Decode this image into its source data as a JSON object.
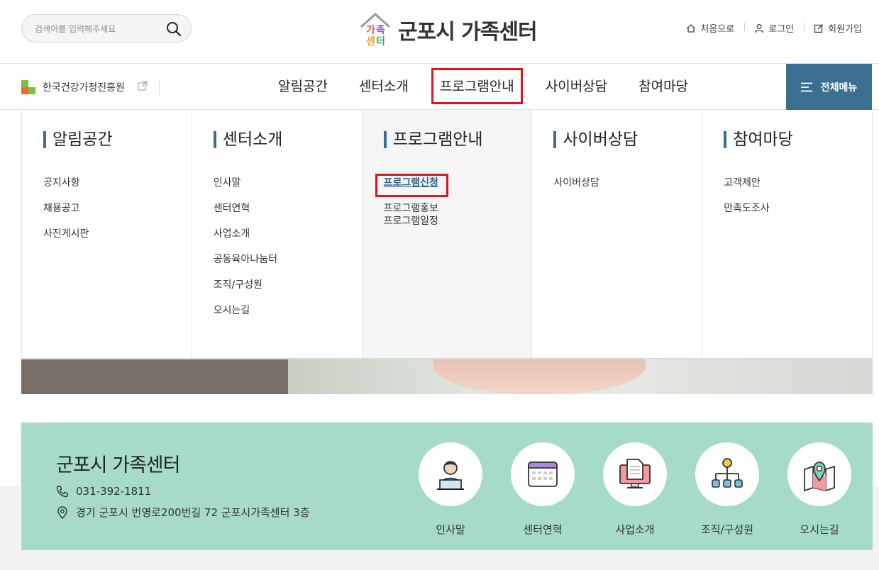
{
  "search": {
    "placeholder": "검색어를 입력해주세요",
    "icon": "search-icon"
  },
  "logo": {
    "mark_text": "가족센터",
    "title": "군포시 가족센터"
  },
  "util_links": [
    {
      "label": "처음으로",
      "icon": "home-icon"
    },
    {
      "label": "로그인",
      "icon": "user-icon"
    },
    {
      "label": "회원가입",
      "icon": "edit-icon"
    }
  ],
  "org": {
    "label": "한국건강가정진흥원",
    "icon": "external-link-icon"
  },
  "nav": [
    "알림공간",
    "센터소개",
    "프로그램안내",
    "사이버상담",
    "참여마당"
  ],
  "all_menu": {
    "label": "전체메뉴",
    "icon": "hamburger-icon"
  },
  "mega": [
    {
      "title": "알림공간",
      "items": [
        "공지사항",
        "채용공고",
        "사진게시판"
      ]
    },
    {
      "title": "센터소개",
      "items": [
        "인사말",
        "센터연혁",
        "사업소개",
        "공동육아나눔터",
        "조직/구성원",
        "오시는길"
      ]
    },
    {
      "title": "프로그램안내",
      "items": [
        "프로그램신청",
        "프로그램홍보",
        "프로그램일정"
      ]
    },
    {
      "title": "사이버상담",
      "items": [
        "사이버상담"
      ]
    },
    {
      "title": "참여마당",
      "items": [
        "고객제안",
        "만족도조사"
      ]
    }
  ],
  "center": {
    "title": "군포시 가족센터",
    "phone": "031-392-1811",
    "address": "경기 군포시 번영로200번길 72 군포시가족센터 3층"
  },
  "quick_links": [
    {
      "label": "인사말",
      "icon": "greeting-person-icon"
    },
    {
      "label": "센터연혁",
      "icon": "calendar-icon"
    },
    {
      "label": "사업소개",
      "icon": "monitor-document-icon"
    },
    {
      "label": "조직/구성원",
      "icon": "org-chart-icon"
    },
    {
      "label": "오시는길",
      "icon": "map-pin-icon"
    }
  ],
  "colors": {
    "accent": "#3a6f8f",
    "highlight": "#e0141e",
    "info_bg": "#a5dbc8"
  }
}
